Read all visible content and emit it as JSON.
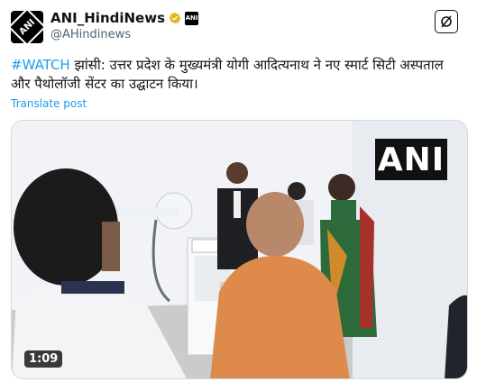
{
  "author": {
    "display_name": "ANI_HindiNews",
    "handle": "@AHindinews",
    "avatar_text": "ANI",
    "affiliate_text": "ANI"
  },
  "tweet": {
    "hashtag": "#WATCH",
    "text": " झांसी: उत्तर प्रदेश के मुख्यमंत्री योगी आदित्यनाथ ने नए स्मार्ट सिटी अस्पताल और पैथोलॉजी सेंटर का उद्घाटन किया।",
    "translate_label": "Translate post"
  },
  "video": {
    "watermark": "ANI",
    "duration": "1:09"
  },
  "colors": {
    "accent": "#1d9bf0",
    "verified_gold": "#e2b719"
  }
}
